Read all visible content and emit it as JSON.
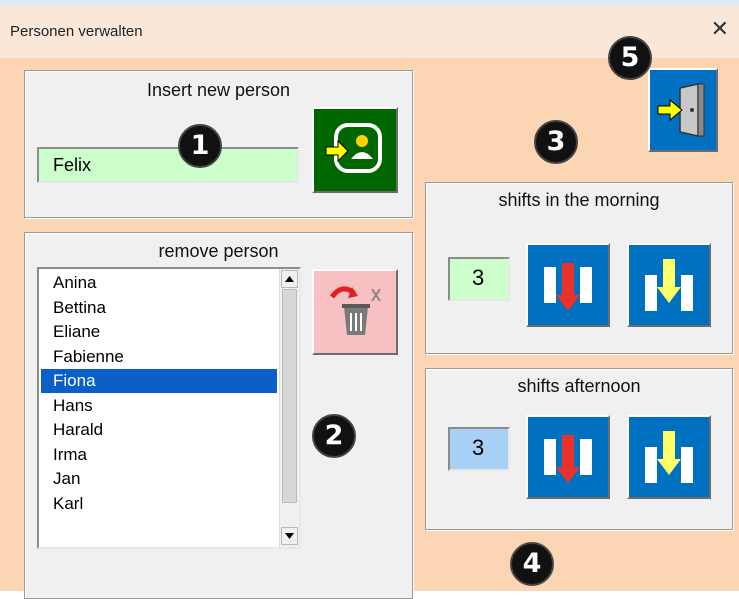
{
  "window": {
    "title": "Personen verwalten",
    "close_glyph": "✕"
  },
  "insert": {
    "label": "Insert new person",
    "input_value": "Felix",
    "add_button_icon": "add-person-icon"
  },
  "remove": {
    "label": "remove person",
    "items": [
      "Anina",
      "Bettina",
      "Eliane",
      "Fabienne",
      "Fiona",
      "Hans",
      "Harald",
      "Irma",
      "Jan",
      "Karl"
    ],
    "selected": "Fiona",
    "delete_button_icon": "trash-delete-icon"
  },
  "morning": {
    "label": "shifts in the morning",
    "value": "3",
    "value_bg": "#ccffcc"
  },
  "afternoon": {
    "label": "shifts afternoon",
    "value": "3",
    "value_bg": "#a8d0f4"
  },
  "badges": [
    "1",
    "2",
    "3",
    "4",
    "5"
  ],
  "colors": {
    "client_bg": "#fcd5b4",
    "title_bg": "#fbe7d8",
    "accent_blue": "#0070c0",
    "accent_green": "#006600",
    "selection": "#0a5fc8"
  }
}
